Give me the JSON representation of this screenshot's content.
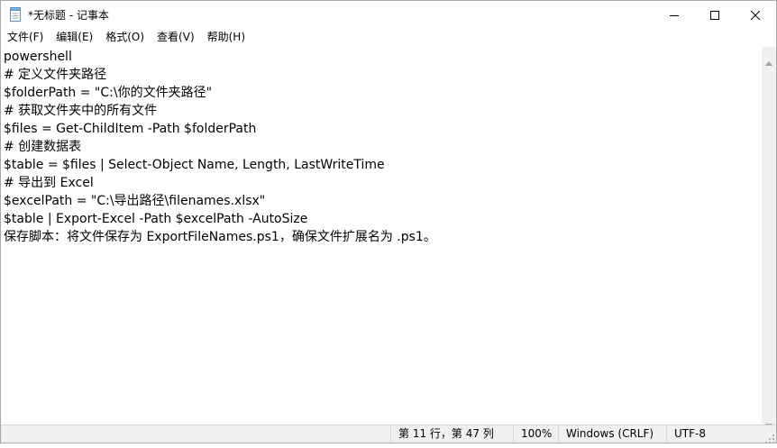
{
  "window": {
    "title": "*无标题 - 记事本",
    "controls": {
      "minimize_icon": "minimize-icon",
      "maximize_icon": "maximize-icon",
      "close_icon": "close-icon"
    }
  },
  "menu": {
    "items": [
      {
        "label": "文件(F)"
      },
      {
        "label": "编辑(E)"
      },
      {
        "label": "格式(O)"
      },
      {
        "label": "查看(V)"
      },
      {
        "label": "帮助(H)"
      }
    ]
  },
  "editor": {
    "lines": [
      "powershell",
      "# 定义文件夹路径",
      "$folderPath = \"C:\\你的文件夹路径\"",
      "# 获取文件夹中的所有文件",
      "$files = Get-ChildItem -Path $folderPath",
      "# 创建数据表",
      "$table = $files | Select-Object Name, Length, LastWriteTime",
      "# 导出到 Excel",
      "$excelPath = \"C:\\导出路径\\filenames.xlsx\"",
      "$table | Export-Excel -Path $excelPath -AutoSize",
      "保存脚本：将文件保存为 ExportFileNames.ps1，确保文件扩展名为 .ps1。"
    ]
  },
  "status": {
    "position": "第 11 行，第 47 列",
    "zoom": "100%",
    "line_ending": "Windows (CRLF)",
    "encoding": "UTF-8"
  },
  "colors": {
    "background": "#ffffff",
    "statusbar": "#f0f0f0",
    "scrollbar": "#f0f0f0"
  }
}
